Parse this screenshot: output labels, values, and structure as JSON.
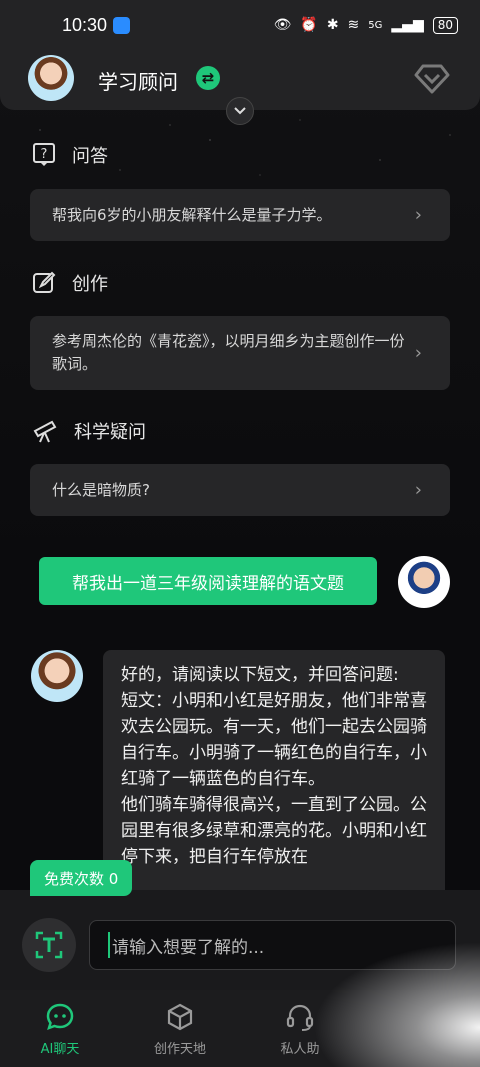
{
  "status_bar": {
    "time": "10:30",
    "network": "5G",
    "battery": "80"
  },
  "header": {
    "title": "学习顾问"
  },
  "sections": [
    {
      "title": "问答",
      "icon": "question-icon",
      "prompt": "帮我向6岁的小朋友解释什么是量子力学。"
    },
    {
      "title": "创作",
      "icon": "edit-icon",
      "prompt": "参考周杰伦的《青花瓷》，以明月细乡为主题创作一份歌词。"
    },
    {
      "title": "科学疑问",
      "icon": "telescope-icon",
      "prompt": "什么是暗物质?"
    }
  ],
  "chat": {
    "user_message": "帮我出一道三年级阅读理解的语文题",
    "bot_lines": [
      "好的，请阅读以下短文，并回答问题:",
      "短文：小明和小红是好朋友，他们非常喜欢去公园玩。有一天，他们一起去公园骑自行车。小明骑了一辆红色的自行车，小红骑了一辆蓝色的自行车。",
      "他们骑车骑得很高兴，一直到了公园。公园里有很多绿草和漂亮的花。小明和小红停下来，把自行车停放在"
    ]
  },
  "free_badge": "免费次数 0",
  "input": {
    "placeholder": "请输入想要了解的..."
  },
  "nav": {
    "items": [
      {
        "label": "AI聊天",
        "icon": "chat-icon",
        "active": true
      },
      {
        "label": "创作天地",
        "icon": "cube-icon",
        "active": false
      },
      {
        "label": "私人助",
        "icon": "headset-icon",
        "active": false
      },
      {
        "label": "",
        "icon": "",
        "active": false
      }
    ]
  },
  "colors": {
    "accent": "#1fc77a",
    "card": "#262628",
    "background": "#0b0b0d"
  }
}
